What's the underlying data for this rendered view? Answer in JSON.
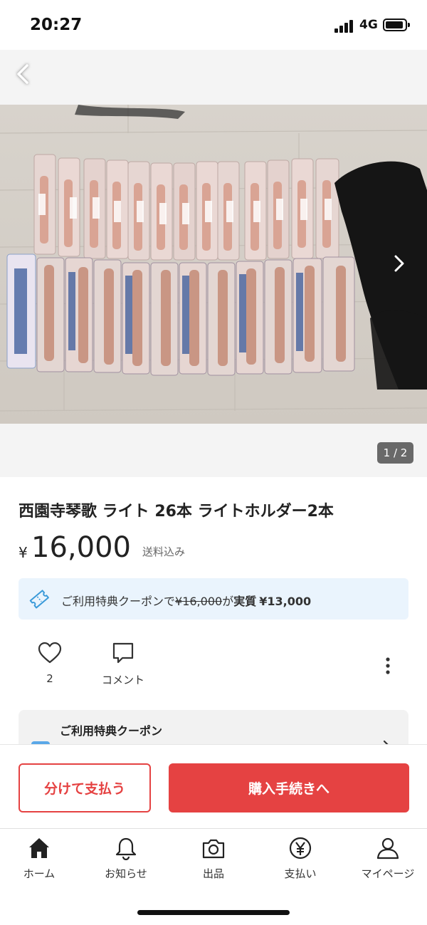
{
  "status_bar": {
    "time": "20:27",
    "network": "4G"
  },
  "gallery": {
    "counter": "1 / 2"
  },
  "item": {
    "title": "西園寺琴歌 ライト 26本 ライトホルダー2本",
    "currency": "¥",
    "price": "16,000",
    "shipping": "送料込み"
  },
  "coupon_banner": {
    "prefix": "ご利用特典クーポンで",
    "original_price": "¥16,000",
    "middle": "が",
    "effective_label": "実質",
    "effective_price": "¥13,000"
  },
  "actions": {
    "like_count": "2",
    "comment_label": "コメント"
  },
  "coupon_card": {
    "title": "ご利用特典クーポン"
  },
  "purchase": {
    "split_label": "分けて支払う",
    "buy_label": "購入手続きへ"
  },
  "tabs": [
    {
      "label": "ホーム",
      "icon": "home-icon"
    },
    {
      "label": "お知らせ",
      "icon": "bell-icon"
    },
    {
      "label": "出品",
      "icon": "camera-icon"
    },
    {
      "label": "支払い",
      "icon": "yen-icon"
    },
    {
      "label": "マイページ",
      "icon": "person-icon"
    }
  ],
  "colors": {
    "accent": "#e54242",
    "coupon_bg": "#eaf4fd",
    "ticket": "#3a9ad9"
  }
}
